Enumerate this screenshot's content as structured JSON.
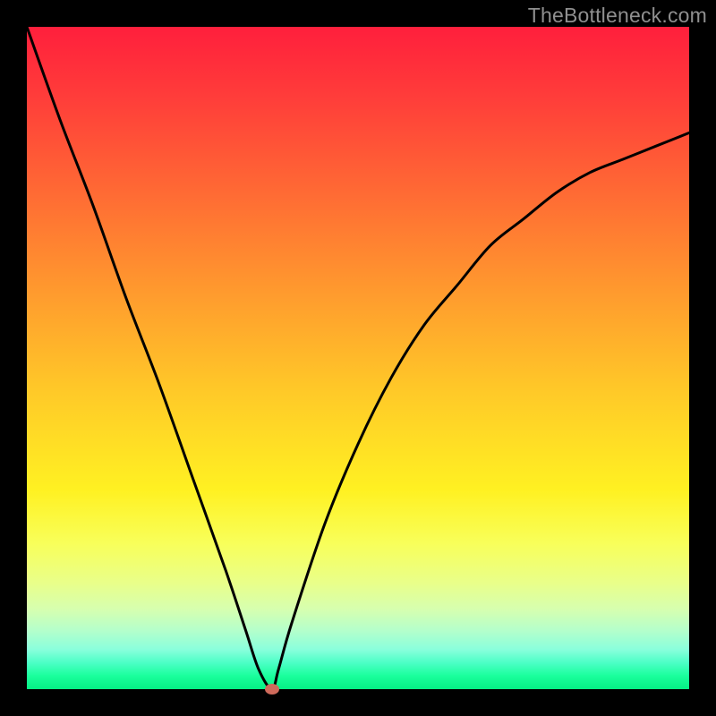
{
  "watermark": "TheBottleneck.com",
  "colors": {
    "frame_bg": "#000000",
    "curve": "#000000",
    "marker": "#cf6a5b",
    "gradient_top": "#ff1f3c",
    "gradient_bottom": "#05ef84"
  },
  "chart_data": {
    "type": "line",
    "title": "",
    "xlabel": "",
    "ylabel": "",
    "xlim": [
      0,
      100
    ],
    "ylim": [
      0,
      100
    ],
    "grid": false,
    "legend": false,
    "series": [
      {
        "name": "bottleneck-curve",
        "x": [
          0,
          5,
          10,
          15,
          20,
          25,
          30,
          33,
          35,
          37,
          38,
          40,
          45,
          50,
          55,
          60,
          65,
          70,
          75,
          80,
          85,
          90,
          95,
          100
        ],
        "y": [
          100,
          86,
          73,
          59,
          46,
          32,
          18,
          9,
          3,
          0,
          3,
          10,
          25,
          37,
          47,
          55,
          61,
          67,
          71,
          75,
          78,
          80,
          82,
          84
        ]
      }
    ],
    "marker": {
      "x": 37,
      "y": 0
    }
  }
}
